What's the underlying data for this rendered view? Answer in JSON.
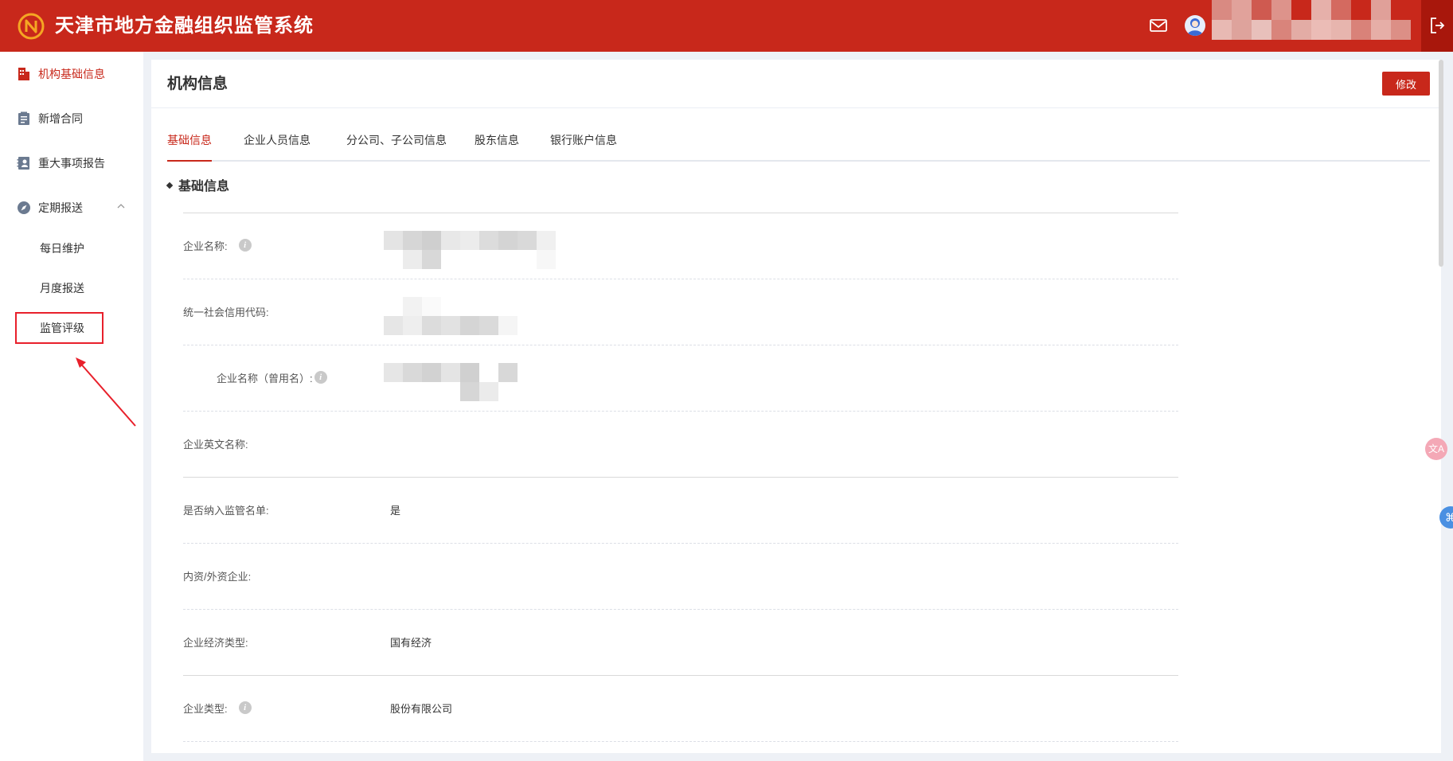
{
  "header": {
    "app_title": "天津市地方金融组织监管系统",
    "logo_icon": "n-logo-icon",
    "mail_icon": "mail-icon",
    "logout_icon": "logout-icon",
    "brand_color": "#c8281b"
  },
  "sidebar": {
    "items": [
      {
        "label": "机构基础信息",
        "icon": "building-icon",
        "active": true
      },
      {
        "label": "新增合同",
        "icon": "clipboard-icon",
        "active": false
      },
      {
        "label": "重大事项报告",
        "icon": "contacts-icon",
        "active": false
      },
      {
        "label": "定期报送",
        "icon": "compass-icon",
        "active": false,
        "expanded": true
      }
    ],
    "sub_items": [
      {
        "label": "每日维护"
      },
      {
        "label": "月度报送"
      },
      {
        "label": "监管评级",
        "highlighted": true
      }
    ]
  },
  "main": {
    "title": "机构信息",
    "edit_label": "修改",
    "tabs": [
      {
        "label": "基础信息",
        "active": true
      },
      {
        "label": "企业人员信息",
        "active": false
      },
      {
        "label": "分公司、子公司信息",
        "active": false
      },
      {
        "label": "股东信息",
        "active": false
      },
      {
        "label": "银行账户信息",
        "active": false
      }
    ],
    "section_title": "基础信息",
    "fields": [
      {
        "label": "企业名称:",
        "value": "",
        "info": true,
        "redacted": true
      },
      {
        "label": "统一社会信用代码:",
        "value": "",
        "info": false,
        "redacted": true
      },
      {
        "label": "企业名称（曾用名）:",
        "value": "",
        "info": true,
        "redacted": true
      },
      {
        "label": "企业英文名称:",
        "value": "",
        "info": false
      },
      {
        "label": "是否纳入监管名单:",
        "value": "是",
        "info": false
      },
      {
        "label": "内资/外资企业:",
        "value": "",
        "info": false
      },
      {
        "label": "企业经济类型:",
        "value": "国有经济",
        "info": false
      },
      {
        "label": "企业类型:",
        "value": "股份有限公司",
        "info": true
      }
    ],
    "info_icon_glyph": "i"
  },
  "floating": {
    "translate_icon": "translate-icon",
    "translate_glyph": "文A",
    "command_icon": "command-icon",
    "command_glyph": "⌘"
  }
}
